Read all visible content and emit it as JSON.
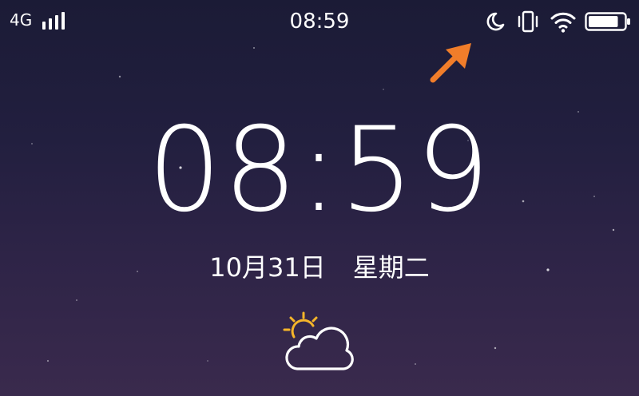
{
  "status_bar": {
    "network": "4G",
    "signal_icon": "signal-bars-icon",
    "time": "08:59",
    "icons": [
      "do-not-disturb-moon-icon",
      "vibrate-icon",
      "wifi-icon",
      "battery-icon"
    ],
    "battery_level": 0.85
  },
  "lock_screen": {
    "clock": "08:59",
    "date": "10月31日",
    "weekday": "星期二",
    "weather_icon": "partly-cloudy-icon"
  },
  "annotation": {
    "arrow_icon": "pointer-arrow-icon",
    "arrow_color": "#f07d2a"
  },
  "colors": {
    "background_top": "#1b1b36",
    "background_bottom": "#3a2a4d",
    "sun": "#f5b52a",
    "text": "#ffffff"
  }
}
